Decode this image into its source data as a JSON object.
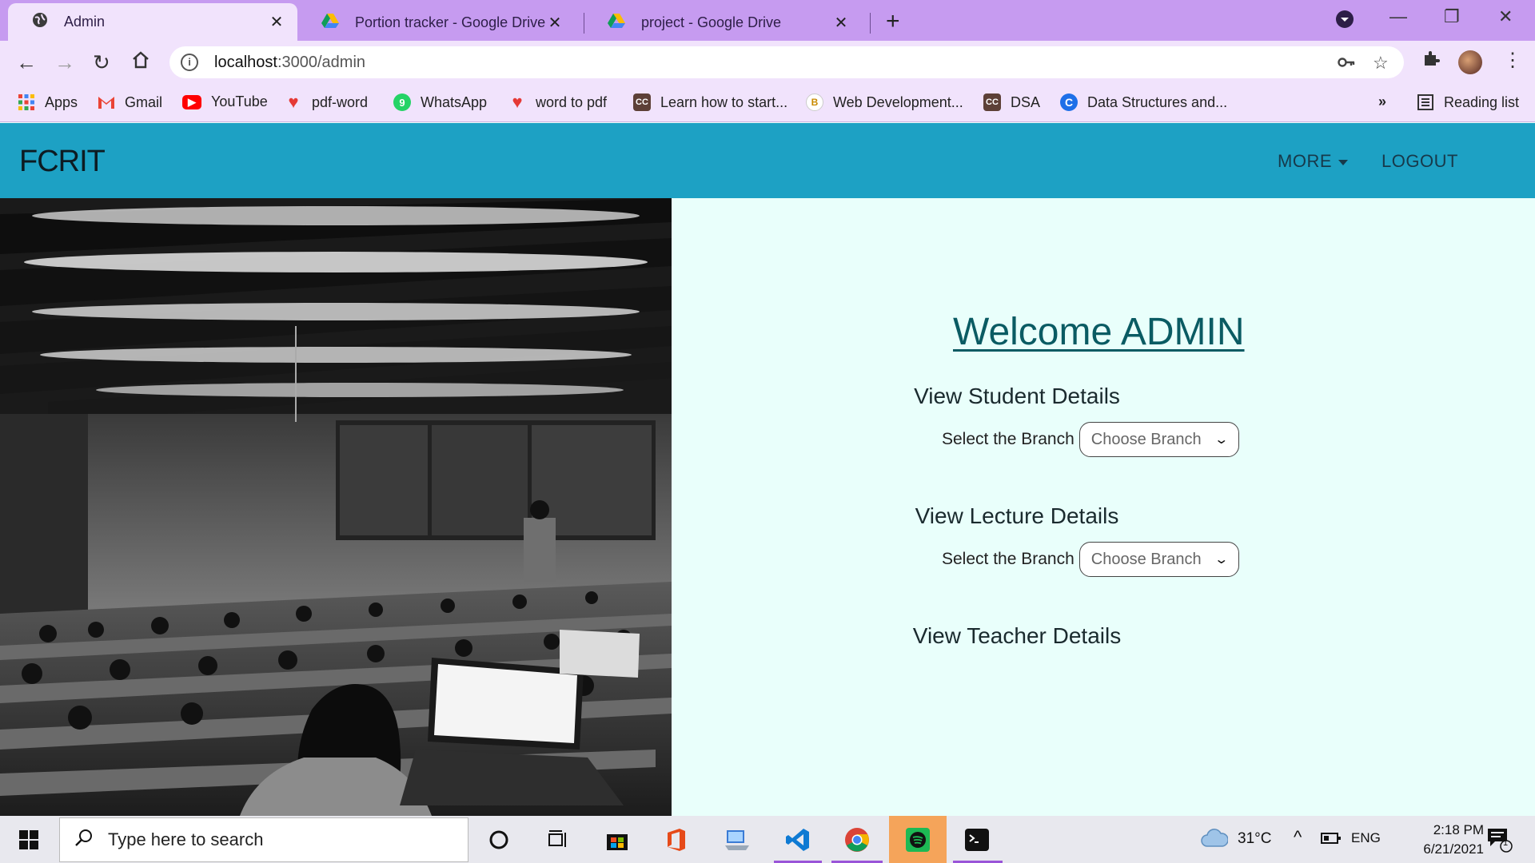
{
  "browser": {
    "tabs": [
      {
        "title": "Admin",
        "active": true
      },
      {
        "title": "Portion tracker - Google Drive",
        "active": false
      },
      {
        "title": "project - Google Drive",
        "active": false
      }
    ],
    "url_host": "localhost",
    "url_path": ":3000/admin",
    "bookmarks": [
      {
        "label": "Apps",
        "icon": "apps-grid-icon",
        "color": "#4285f4"
      },
      {
        "label": "Gmail",
        "icon": "gmail-icon",
        "color": "#ea4335"
      },
      {
        "label": "YouTube",
        "icon": "youtube-icon",
        "color": "#ff0000"
      },
      {
        "label": "pdf-word",
        "icon": "heart-icon",
        "color": "#e53935"
      },
      {
        "label": "WhatsApp",
        "icon": "whatsapp-icon",
        "color": "#25d366"
      },
      {
        "label": "word to pdf",
        "icon": "heart-icon",
        "color": "#e53935"
      },
      {
        "label": "Learn how to start...",
        "icon": "cc-icon",
        "color": "#5d4037"
      },
      {
        "label": "Web Development...",
        "icon": "web-dev-icon",
        "color": "#f5b400"
      },
      {
        "label": "DSA",
        "icon": "cc-icon",
        "color": "#5d4037"
      },
      {
        "label": "Data Structures and...",
        "icon": "c-icon",
        "color": "#1e6fe8"
      }
    ],
    "reading_list": "Reading list",
    "overflow": "»"
  },
  "app": {
    "brand": "FCRIT",
    "nav_more": "MORE",
    "nav_logout": "LOGOUT",
    "welcome": "Welcome ADMIN",
    "sections": [
      {
        "title": "View Student Details",
        "select_label": "Select the Branch",
        "select_value": "Choose Branch"
      },
      {
        "title": "View Lecture Details",
        "select_label": "Select the Branch",
        "select_value": "Choose Branch"
      },
      {
        "title": "View Teacher Details"
      }
    ]
  },
  "taskbar": {
    "search_placeholder": "Type here to search",
    "weather": "31°C",
    "language": "ENG",
    "time": "2:18 PM",
    "date": "6/21/2021",
    "notification_count": "1"
  }
}
